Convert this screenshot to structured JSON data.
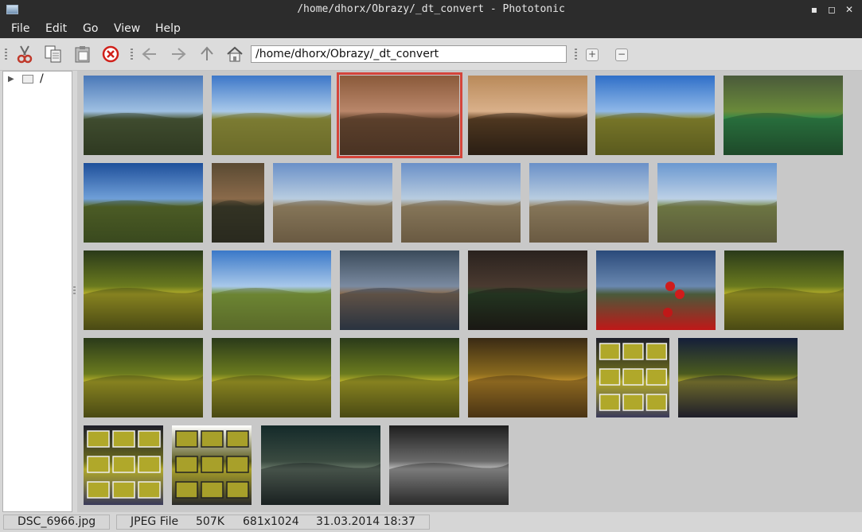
{
  "window": {
    "title": "/home/dhorx/Obrazy/_dt_convert - Phototonic",
    "minimize": "▪",
    "maximize": "◻",
    "close": "✕"
  },
  "menu": [
    "File",
    "Edit",
    "Go",
    "View",
    "Help"
  ],
  "toolbar": {
    "icons": [
      "cut-icon",
      "copy-icon",
      "paste-icon",
      "delete-icon",
      "back-icon",
      "forward-icon",
      "up-icon",
      "home-icon"
    ],
    "path": "/home/dhorx/Obrazy/_dt_convert",
    "zoom_in": "+",
    "zoom_out": "−"
  },
  "sidebar": {
    "root_label": "/",
    "expand_icon": "▶"
  },
  "thumbnails": [
    {
      "kind": "mountain-sky",
      "selected": false
    },
    {
      "kind": "meadow-sky",
      "selected": false
    },
    {
      "kind": "forest-stream",
      "selected": true
    },
    {
      "kind": "salamander-leaves",
      "selected": false
    },
    {
      "kind": "meadow-tree-autumn",
      "selected": false
    },
    {
      "kind": "green-marsh",
      "selected": false
    },
    {
      "kind": "tree-blue-sky",
      "selected": false
    },
    {
      "kind": "narrow-creek",
      "selected": false
    },
    {
      "kind": "bare-tree-field",
      "selected": false
    },
    {
      "kind": "bare-tree-field",
      "selected": false
    },
    {
      "kind": "bare-tree-field",
      "selected": false
    },
    {
      "kind": "big-tree-field",
      "selected": false
    },
    {
      "kind": "yellow-hills",
      "selected": false
    },
    {
      "kind": "willow-sky",
      "selected": false
    },
    {
      "kind": "stream-rocks",
      "selected": false
    },
    {
      "kind": "dark-forest",
      "selected": false
    },
    {
      "kind": "red-berries",
      "selected": false
    },
    {
      "kind": "yellow-hills",
      "selected": false
    },
    {
      "kind": "yellow-hills",
      "selected": false
    },
    {
      "kind": "yellow-hills",
      "selected": false
    },
    {
      "kind": "yellow-hills",
      "selected": false
    },
    {
      "kind": "yellow-hills-warm",
      "selected": false
    },
    {
      "kind": "collage-dark",
      "selected": false
    },
    {
      "kind": "yellow-hills-dark",
      "selected": false
    },
    {
      "kind": "collage-dark",
      "selected": false
    },
    {
      "kind": "collage-white",
      "selected": false
    },
    {
      "kind": "dark-teal-hills",
      "selected": false
    },
    {
      "kind": "bw-hills",
      "selected": false
    }
  ],
  "status": {
    "filename": "DSC_6966.jpg",
    "type": "JPEG File",
    "size": "507K",
    "dimensions": "681x1024",
    "date": "31.03.2014 18:37"
  }
}
